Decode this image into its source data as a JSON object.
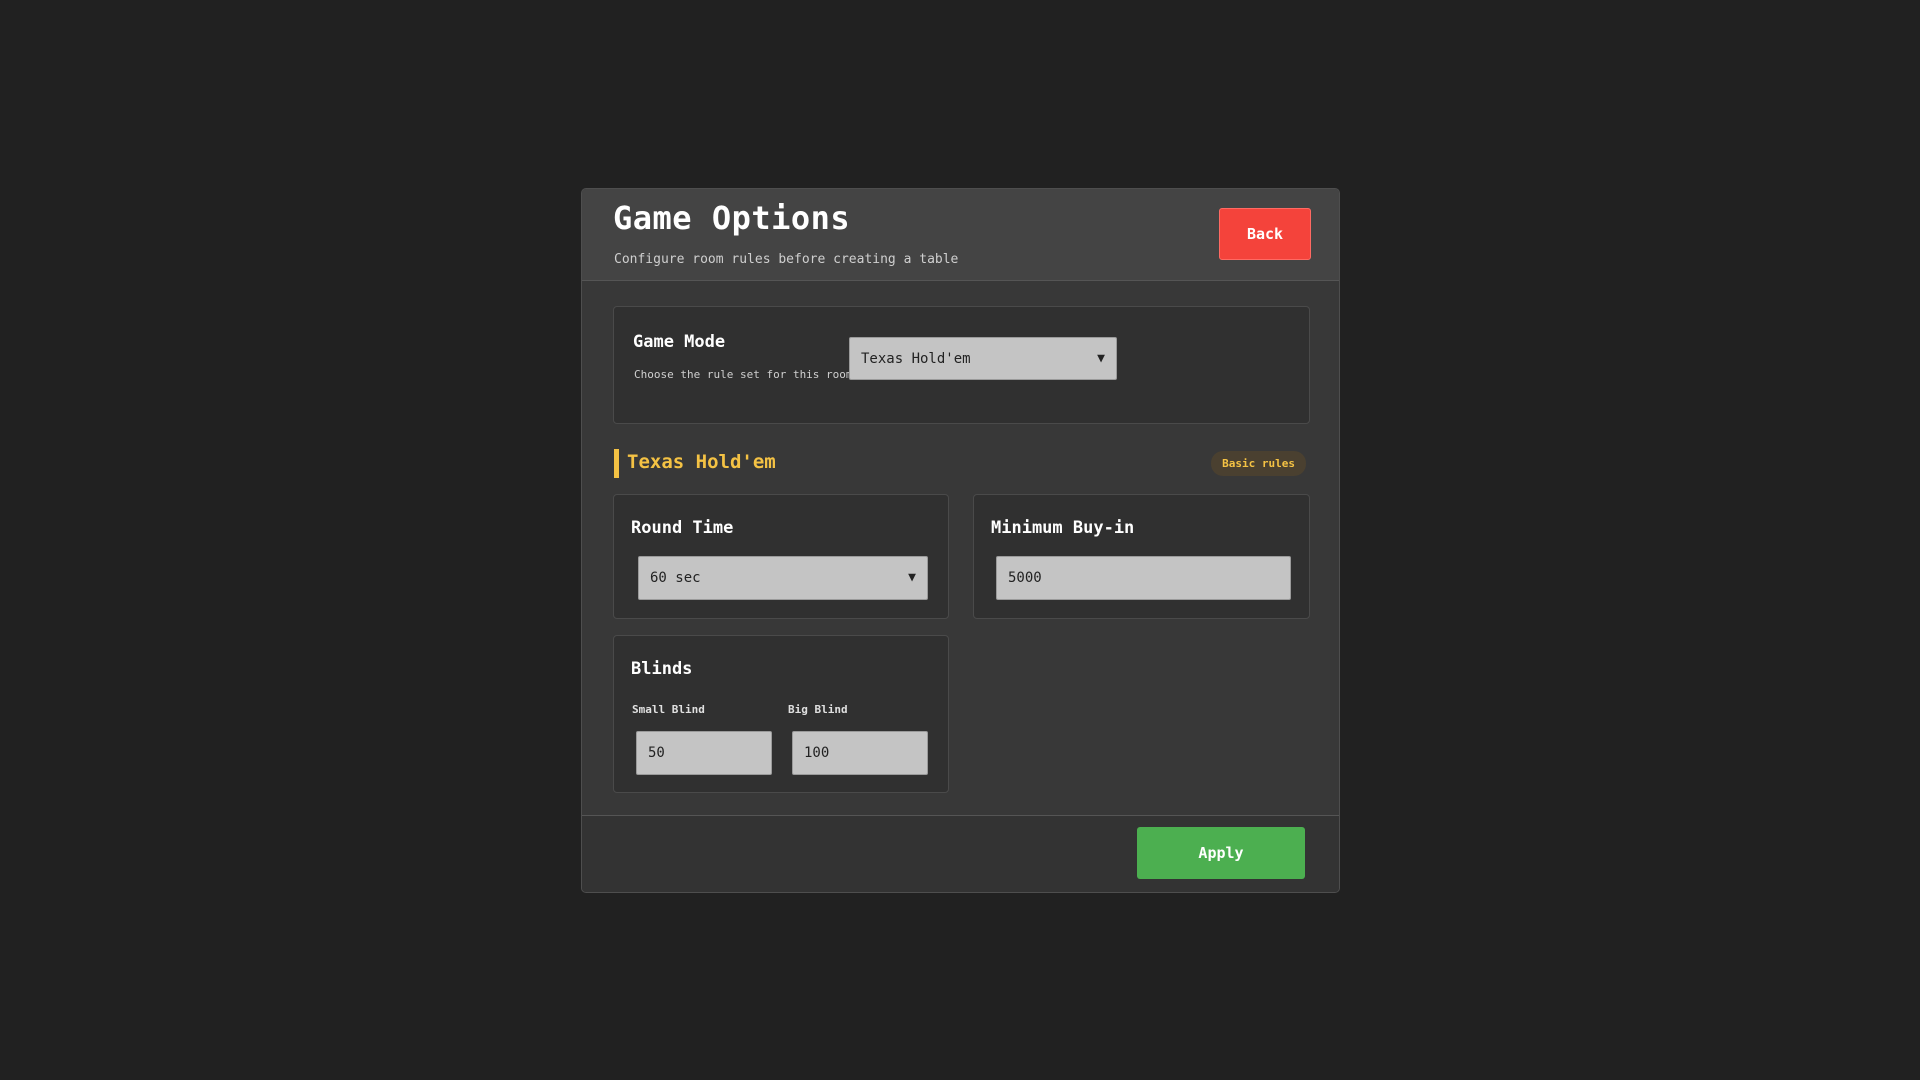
{
  "header": {
    "title": "Game Options",
    "subtitle": "Configure room rules before creating a table",
    "back_label": "Back"
  },
  "game_mode": {
    "label": "Game Mode",
    "description": "Choose the rule set for this room",
    "selected": "Texas Hold'em"
  },
  "section": {
    "title": "Texas Hold'em",
    "badge": "Basic rules"
  },
  "round_time": {
    "label": "Round Time",
    "selected": "60 sec"
  },
  "buy_in": {
    "label": "Minimum Buy-in",
    "value": "5000"
  },
  "blinds": {
    "label": "Blinds",
    "small_label": "Small Blind",
    "small_value": "50",
    "big_label": "Big Blind",
    "big_value": "100"
  },
  "footer": {
    "apply_label": "Apply"
  },
  "colors": {
    "background": "#212121",
    "back_button": "#f4433b",
    "apply_button": "#4caf50",
    "accent": "#f4c244"
  },
  "icons": {
    "dropdown": "chevron-down-icon"
  }
}
